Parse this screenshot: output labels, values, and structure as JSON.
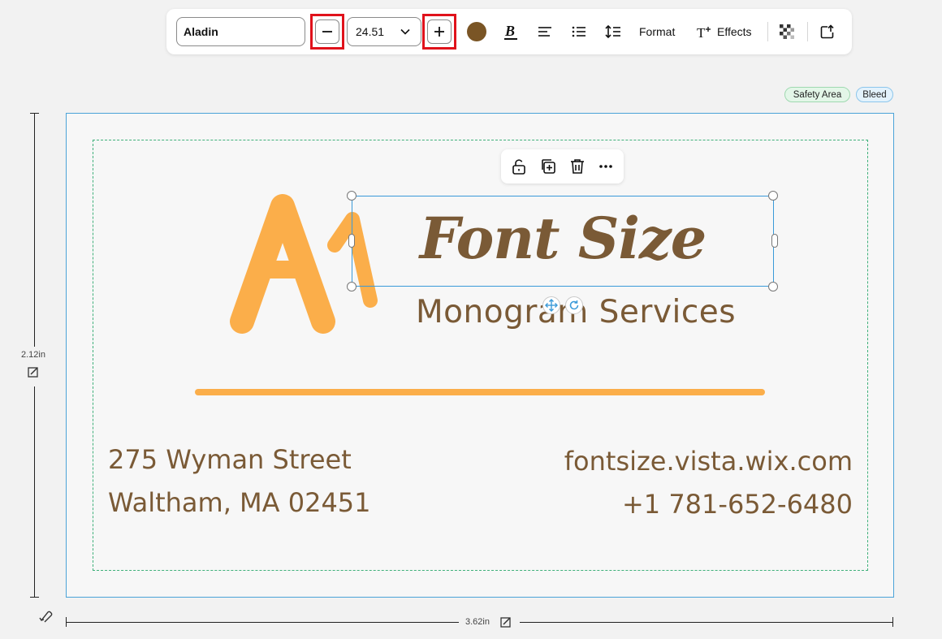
{
  "toolbar": {
    "font_name": "Aladin",
    "font_size": "24.51",
    "text_color": "#7a5525",
    "format_label": "Format",
    "effects_label": "Effects",
    "icons": [
      "minus-icon",
      "chevron-down-icon",
      "plus-icon",
      "bold-icon",
      "align-left-icon",
      "list-icon",
      "line-spacing-icon",
      "text-effects-icon",
      "transparency-icon",
      "share-icon"
    ]
  },
  "badges": {
    "safety_area": "Safety Area",
    "bleed": "Bleed"
  },
  "dimensions": {
    "height": "2.12in",
    "width": "3.62in"
  },
  "context_menu": {
    "icons": [
      "unlock-icon",
      "duplicate-icon",
      "trash-icon",
      "more-icon"
    ]
  },
  "card": {
    "title": "Font Size",
    "subtitle": "Monogram Services",
    "address_line1": "275 Wyman Street",
    "address_line2": "Waltham, MA 02451",
    "website": "fontsize.vista.wix.com",
    "phone": "+1 781-652-6480",
    "text_color": "#7a5a36",
    "accent_color": "#fbae4a"
  }
}
